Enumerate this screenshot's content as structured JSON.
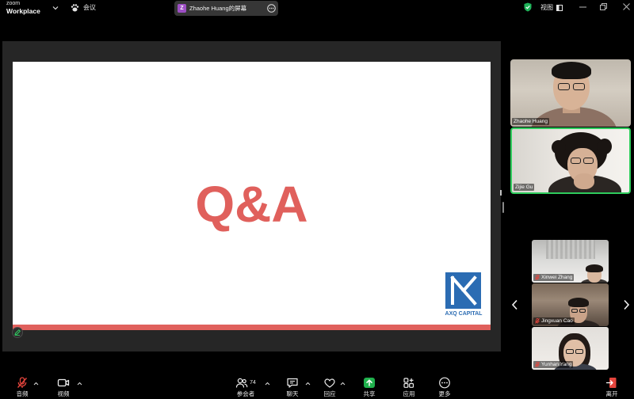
{
  "app": {
    "brand_top": "zoom",
    "brand_bottom": "Workplace",
    "meeting_menu_label": "会议"
  },
  "share_tab": {
    "avatar_letter": "Z",
    "title": "Zhaohe Huang的屏幕",
    "icon": "ellipsis-circle-icon"
  },
  "header_right": {
    "security_icon": "shield-check-icon",
    "view_label": "视图",
    "view_icon": "layout-icon"
  },
  "shared_slide": {
    "title": "Q&A",
    "logo_text": "AXQ CAPITAL",
    "annotate_icon": "pencil-icon"
  },
  "video_panel": {
    "featured": [
      {
        "name": "Zhaohe Huang",
        "active_speaker": false
      },
      {
        "name": "Zijie Gu",
        "active_speaker": true
      }
    ],
    "gallery": [
      {
        "name": "Xinwei Zhang",
        "muted": true
      },
      {
        "name": "Jingxuan Cao",
        "muted": true
      },
      {
        "name": "Yunhan Yang",
        "muted": true
      }
    ]
  },
  "toolbar": {
    "items": [
      {
        "label": "音频",
        "icon": "microphone-muted-icon",
        "has_menu": true
      },
      {
        "label": "视频",
        "icon": "video-camera-icon",
        "has_menu": true
      },
      {
        "label": "参会者",
        "icon": "participants-icon",
        "count": "74",
        "has_menu": true
      },
      {
        "label": "聊天",
        "icon": "chat-icon",
        "has_menu": true
      },
      {
        "label": "回应",
        "icon": "heart-icon",
        "has_menu": true
      },
      {
        "label": "共享",
        "icon": "share-screen-icon",
        "has_menu": false
      },
      {
        "label": "应用",
        "icon": "apps-icon",
        "has_menu": false
      },
      {
        "label": "更多",
        "icon": "more-icon",
        "has_menu": false
      },
      {
        "label": "离开",
        "icon": "leave-icon",
        "has_menu": false
      }
    ]
  },
  "colors": {
    "slide_red": "#e0605c",
    "logo_blue": "#2b6cb3",
    "speaker_green": "#2ecc5c",
    "share_green": "#20b14d",
    "muted_red": "#e5453d",
    "avatar_purple": "#9d4fc4",
    "security_green": "#1fb45a"
  }
}
